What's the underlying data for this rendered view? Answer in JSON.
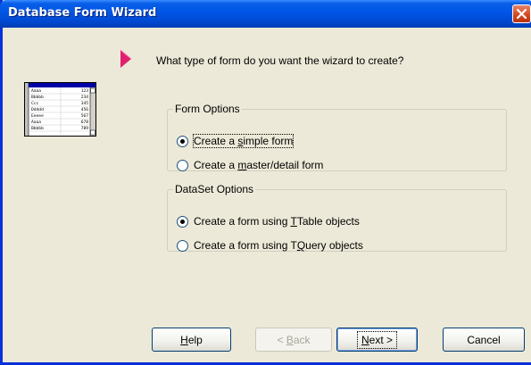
{
  "window": {
    "title": "Database Form Wizard",
    "close_icon": "close-icon",
    "colors": {
      "titlebar": "#0055e5",
      "face": "#ece9d8",
      "pointer": "#e0206e"
    }
  },
  "prompt": {
    "icon": "pointer-arrow-icon",
    "text": "What type of form do you want the wizard to create?"
  },
  "illustration": {
    "icon": "grid-table-icon",
    "rows": [
      {
        "name": "Aaaa",
        "value": "123"
      },
      {
        "name": "Bbbbb",
        "value": "234"
      },
      {
        "name": "Ccc",
        "value": "345"
      },
      {
        "name": "Ddddd",
        "value": "456"
      },
      {
        "name": "Eeeee",
        "value": "567"
      },
      {
        "name": "Aaaa",
        "value": "678"
      },
      {
        "name": "Bbbbb",
        "value": "789"
      }
    ]
  },
  "form_options": {
    "legend": "Form Options",
    "options": [
      {
        "pre": "Create a ",
        "key": "s",
        "post": "imple form",
        "checked": true
      },
      {
        "pre": "Create a ",
        "key": "m",
        "post": "aster/detail form",
        "checked": false
      }
    ]
  },
  "dataset_options": {
    "legend": "DataSet Options",
    "options": [
      {
        "pre": "Create a form using ",
        "key": "T",
        "post": "Table objects",
        "checked": true
      },
      {
        "pre": "Create a form using T",
        "key": "Q",
        "post": "uery objects",
        "checked": false
      }
    ]
  },
  "buttons": {
    "help": {
      "key": "H",
      "rest": "elp"
    },
    "back": {
      "pre": "< ",
      "key": "B",
      "rest": "ack",
      "disabled": true
    },
    "next": {
      "key": "N",
      "rest": "ext >"
    },
    "cancel": {
      "label": "Cancel"
    }
  }
}
